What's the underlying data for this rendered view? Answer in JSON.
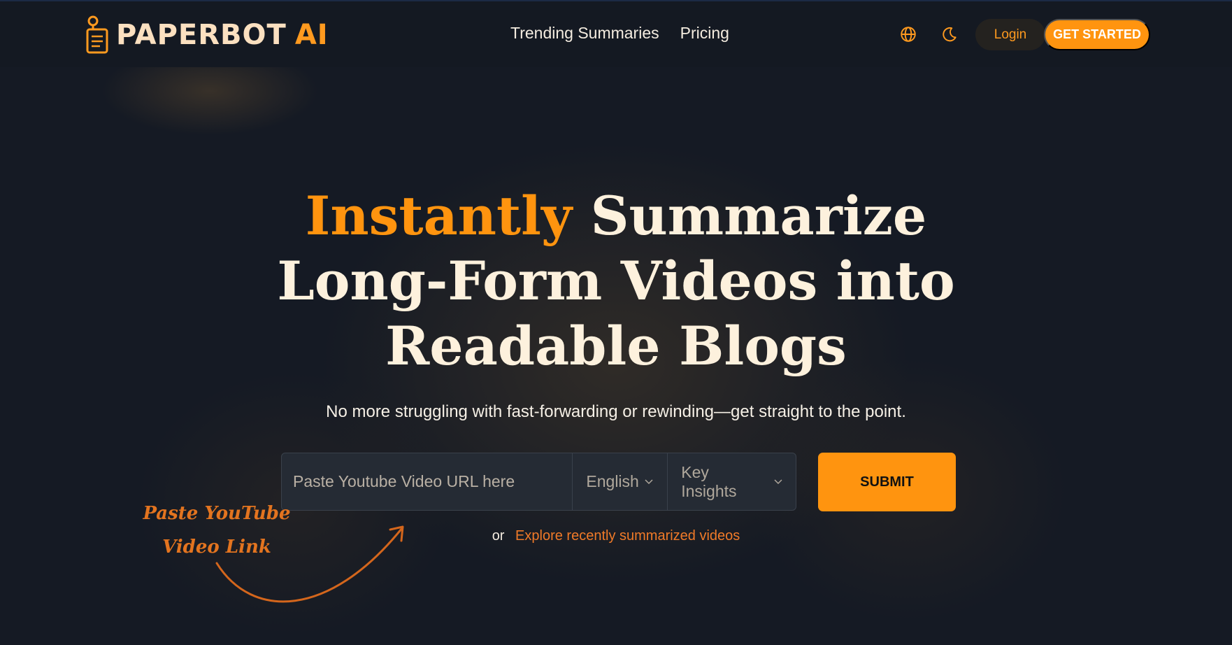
{
  "brand": {
    "name": "PAPERBOT",
    "suffix": "AI"
  },
  "nav": {
    "items": [
      "Trending Summaries",
      "Pricing"
    ]
  },
  "header": {
    "language_icon": "globe-icon",
    "theme_icon": "moon-icon",
    "login_label": "Login",
    "get_started_label": "GET STARTED"
  },
  "hero": {
    "title_accent": "Instantly",
    "title_line1_rest": "Summarize",
    "title_line2": "Long-Form Videos into",
    "title_line3": "Readable Blogs",
    "subtitle": "No more struggling with fast-forwarding or rewinding—get straight to the point."
  },
  "form": {
    "url_placeholder": "Paste Youtube Video URL here",
    "language_selected": "English",
    "style_selected": "Key Insights",
    "submit_label": "SUBMIT"
  },
  "explore": {
    "prefix": "or",
    "link_label": "Explore recently summarized videos"
  },
  "annotation": {
    "line1": "Paste YouTube",
    "line2": "Video Link"
  },
  "colors": {
    "background": "#151a24",
    "accent": "#ff940f",
    "title": "#fdf1dd",
    "link": "#f07a28"
  }
}
